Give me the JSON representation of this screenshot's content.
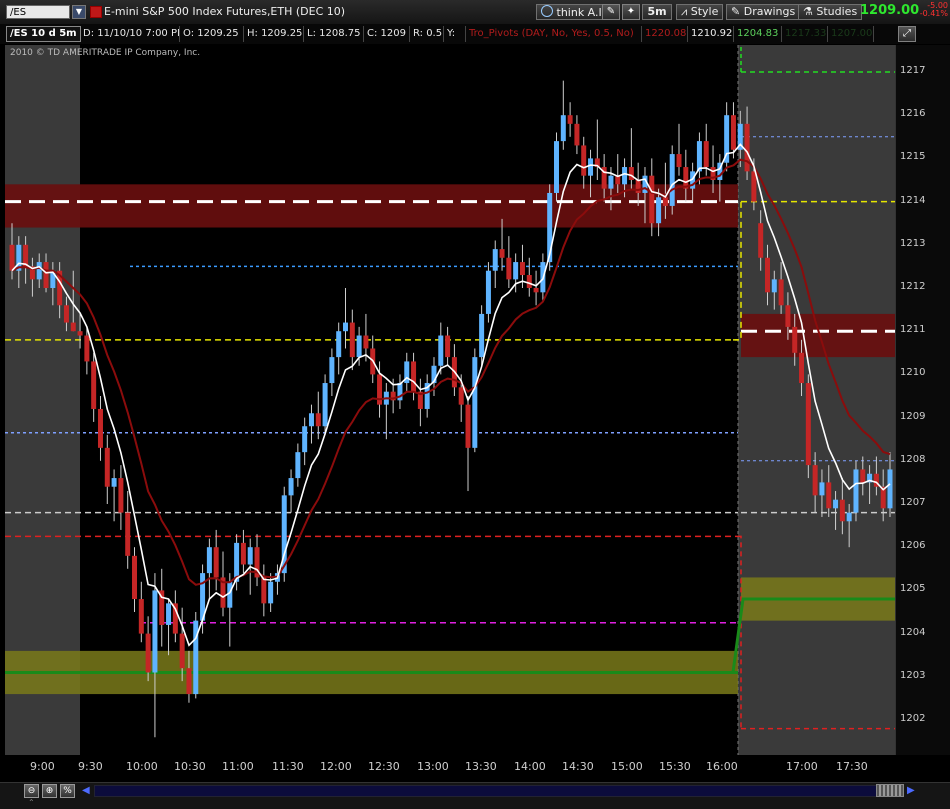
{
  "toolbar": {
    "symbol": "/ES",
    "title": "E-mini S&P 500 Index Futures,ETH (DEC 10)",
    "think_ai": "think A.I.",
    "timeframe": "5m",
    "style": "Style",
    "drawings": "Drawings",
    "studies": "Studies",
    "last_price": "1209.00",
    "net_change": "-5.00",
    "net_change_pct": "-0.41%"
  },
  "infobar": {
    "period": "/ES 10 d 5m",
    "date": "D: 11/10/10 7:00 PM",
    "open": "O: 1209.25",
    "high": "H: 1209.25",
    "low": "L: 1208.75",
    "close": "C: 1209",
    "range": "R: 0.5",
    "y": "Y:",
    "study": "Tro_Pivots (DAY, No, Yes, 0.5, No)",
    "v1": "1220.08",
    "v2": "1210.92",
    "v3": "1204.83",
    "v4": "1217.33",
    "v5": "1207.00"
  },
  "copyright": "2010 © TD AMERITRADE IP Company, Inc.",
  "colors": {
    "bull": "#5fb4ff",
    "bear": "#c52626",
    "ema_fast": "#ffffff",
    "ema_slow": "#8b0c0c",
    "resistance_zone": "#6a0e0e",
    "support_zone": "#7a7a1a"
  },
  "chart_data": {
    "type": "candlestick",
    "title": "E-mini S&P 500 Index Futures,ETH (DEC 10)",
    "ylim": [
      1201.5,
      1217.5
    ],
    "y_ticks": [
      "1217",
      "1216",
      "1215",
      "1214",
      "1213",
      "1212",
      "1211",
      "1210",
      "1209",
      "1208",
      "1207",
      "1206",
      "1205",
      "1204",
      "1203",
      "1202"
    ],
    "x_ticks": [
      "9:00",
      "9:30",
      "10:00",
      "10:30",
      "11:00",
      "11:30",
      "12:00",
      "12:30",
      "13:00",
      "13:30",
      "14:00",
      "14:30",
      "15:00",
      "15:30",
      "16:00",
      "17:00",
      "17:30"
    ],
    "regular_session": [
      "9:30",
      "16:15"
    ],
    "levels": [
      {
        "name": "day-high-pivot",
        "value": 1214.0,
        "color": "#ffffff",
        "style": "dash-thick"
      },
      {
        "name": "blue-dotted",
        "value": 1212.5,
        "color": "#3a9bff",
        "style": "dot"
      },
      {
        "name": "yellow-dash",
        "value": 1210.8,
        "color": "#e6e600",
        "style": "dash"
      },
      {
        "name": "light-blue",
        "value": 1208.65,
        "color": "#7fa0ff",
        "style": "dot"
      },
      {
        "name": "gray-dash",
        "value": 1206.8,
        "color": "#cccccc",
        "style": "dash"
      },
      {
        "name": "red-dash",
        "value": 1206.25,
        "color": "#e02020",
        "style": "dash"
      },
      {
        "name": "magenta-dash",
        "value": 1204.25,
        "color": "#e020e0",
        "style": "dash"
      },
      {
        "name": "green-line",
        "value": 1203.1,
        "color": "#1a8a1a",
        "style": "solid"
      }
    ],
    "candles": [
      [
        1213.0,
        1213.5,
        1212.2,
        1212.4
      ],
      [
        1212.4,
        1213.2,
        1212.0,
        1213.0
      ],
      [
        1213.0,
        1213.2,
        1212.1,
        1212.5
      ],
      [
        1212.5,
        1212.7,
        1211.8,
        1212.2
      ],
      [
        1212.2,
        1212.8,
        1212.0,
        1212.6
      ],
      [
        1212.6,
        1212.8,
        1211.9,
        1212.0
      ],
      [
        1212.0,
        1212.6,
        1211.6,
        1212.4
      ],
      [
        1212.4,
        1212.6,
        1211.3,
        1211.6
      ],
      [
        1211.6,
        1211.8,
        1211.0,
        1211.2
      ],
      [
        1211.2,
        1212.4,
        1211.0,
        1211.0
      ],
      [
        1211.0,
        1211.4,
        1210.6,
        1210.9
      ],
      [
        1210.9,
        1211.1,
        1210.0,
        1210.3
      ],
      [
        1210.3,
        1210.5,
        1208.9,
        1209.2
      ],
      [
        1209.2,
        1209.5,
        1208.0,
        1208.3
      ],
      [
        1208.3,
        1208.6,
        1207.0,
        1207.4
      ],
      [
        1207.4,
        1207.8,
        1206.6,
        1207.6
      ],
      [
        1207.6,
        1207.9,
        1206.4,
        1206.8
      ],
      [
        1206.8,
        1207.3,
        1205.5,
        1205.8
      ],
      [
        1205.8,
        1206.0,
        1204.5,
        1204.8
      ],
      [
        1204.8,
        1205.2,
        1203.8,
        1204.0
      ],
      [
        1204.0,
        1204.4,
        1202.9,
        1203.1
      ],
      [
        1203.1,
        1205.4,
        1201.6,
        1205.0
      ],
      [
        1205.0,
        1205.5,
        1203.7,
        1204.2
      ],
      [
        1204.2,
        1204.8,
        1203.5,
        1204.7
      ],
      [
        1204.7,
        1205.0,
        1203.8,
        1204.0
      ],
      [
        1204.0,
        1204.6,
        1202.9,
        1203.2
      ],
      [
        1203.2,
        1203.6,
        1202.4,
        1202.6
      ],
      [
        1202.6,
        1204.5,
        1202.5,
        1204.3
      ],
      [
        1204.3,
        1205.6,
        1204.0,
        1205.4
      ],
      [
        1205.4,
        1206.2,
        1204.8,
        1206.0
      ],
      [
        1206.0,
        1206.4,
        1205.0,
        1205.3
      ],
      [
        1205.3,
        1205.9,
        1204.4,
        1204.6
      ],
      [
        1204.6,
        1205.4,
        1203.7,
        1205.2
      ],
      [
        1205.2,
        1206.3,
        1205.0,
        1206.1
      ],
      [
        1206.1,
        1206.4,
        1205.4,
        1205.6
      ],
      [
        1205.6,
        1206.2,
        1204.9,
        1206.0
      ],
      [
        1206.0,
        1206.3,
        1205.1,
        1205.3
      ],
      [
        1205.3,
        1205.6,
        1204.4,
        1204.7
      ],
      [
        1204.7,
        1205.4,
        1204.5,
        1205.2
      ],
      [
        1205.2,
        1205.6,
        1204.9,
        1205.4
      ],
      [
        1205.4,
        1207.4,
        1205.2,
        1207.2
      ],
      [
        1207.2,
        1207.8,
        1206.8,
        1207.6
      ],
      [
        1207.6,
        1208.4,
        1207.4,
        1208.2
      ],
      [
        1208.2,
        1209.0,
        1207.9,
        1208.8
      ],
      [
        1208.8,
        1209.3,
        1208.4,
        1209.1
      ],
      [
        1209.1,
        1209.6,
        1208.5,
        1208.8
      ],
      [
        1208.8,
        1210.0,
        1208.6,
        1209.8
      ],
      [
        1209.8,
        1210.6,
        1209.5,
        1210.4
      ],
      [
        1210.4,
        1211.2,
        1210.0,
        1211.0
      ],
      [
        1211.0,
        1212.0,
        1210.6,
        1211.2
      ],
      [
        1211.2,
        1211.5,
        1210.1,
        1210.4
      ],
      [
        1210.4,
        1211.1,
        1210.2,
        1210.9
      ],
      [
        1210.9,
        1211.4,
        1210.3,
        1210.6
      ],
      [
        1210.6,
        1210.9,
        1209.8,
        1210.0
      ],
      [
        1210.0,
        1210.3,
        1209.0,
        1209.3
      ],
      [
        1209.3,
        1209.8,
        1208.5,
        1209.6
      ],
      [
        1209.6,
        1209.9,
        1209.1,
        1209.4
      ],
      [
        1209.4,
        1210.0,
        1209.2,
        1209.8
      ],
      [
        1209.8,
        1210.5,
        1209.6,
        1210.3
      ],
      [
        1210.3,
        1210.5,
        1209.4,
        1209.6
      ],
      [
        1209.6,
        1209.9,
        1208.8,
        1209.2
      ],
      [
        1209.2,
        1210.0,
        1209.0,
        1209.8
      ],
      [
        1209.8,
        1210.4,
        1209.5,
        1210.2
      ],
      [
        1210.2,
        1211.2,
        1210.0,
        1210.9
      ],
      [
        1210.9,
        1211.1,
        1210.2,
        1210.4
      ],
      [
        1210.4,
        1210.7,
        1209.5,
        1209.7
      ],
      [
        1209.7,
        1210.0,
        1208.9,
        1209.3
      ],
      [
        1209.3,
        1209.5,
        1207.3,
        1208.3
      ],
      [
        1208.3,
        1210.6,
        1208.2,
        1210.4
      ],
      [
        1210.4,
        1211.6,
        1210.2,
        1211.4
      ],
      [
        1211.4,
        1212.6,
        1211.2,
        1212.4
      ],
      [
        1212.4,
        1213.1,
        1212.0,
        1212.9
      ],
      [
        1212.9,
        1213.6,
        1212.4,
        1212.7
      ],
      [
        1212.7,
        1213.2,
        1212.0,
        1212.2
      ],
      [
        1212.2,
        1212.8,
        1211.9,
        1212.6
      ],
      [
        1212.6,
        1213.0,
        1212.0,
        1212.3
      ],
      [
        1212.3,
        1212.7,
        1211.8,
        1212.0
      ],
      [
        1212.0,
        1212.4,
        1211.6,
        1211.9
      ],
      [
        1211.9,
        1212.8,
        1211.7,
        1212.6
      ],
      [
        1212.6,
        1214.4,
        1212.4,
        1214.2
      ],
      [
        1214.2,
        1215.6,
        1214.0,
        1215.4
      ],
      [
        1215.4,
        1216.8,
        1215.2,
        1216.0
      ],
      [
        1216.0,
        1216.3,
        1215.5,
        1215.8
      ],
      [
        1215.8,
        1216.0,
        1215.1,
        1215.3
      ],
      [
        1215.3,
        1215.5,
        1214.3,
        1214.6
      ],
      [
        1214.6,
        1215.2,
        1214.1,
        1215.0
      ],
      [
        1215.0,
        1215.9,
        1214.5,
        1214.8
      ],
      [
        1214.8,
        1215.1,
        1214.0,
        1214.3
      ],
      [
        1214.3,
        1214.8,
        1213.8,
        1214.6
      ],
      [
        1214.6,
        1215.1,
        1214.2,
        1214.4
      ],
      [
        1214.4,
        1215.0,
        1214.1,
        1214.8
      ],
      [
        1214.8,
        1215.7,
        1214.3,
        1214.5
      ],
      [
        1214.5,
        1214.9,
        1213.9,
        1214.2
      ],
      [
        1214.2,
        1214.8,
        1213.5,
        1214.6
      ],
      [
        1214.6,
        1215.0,
        1213.2,
        1213.5
      ],
      [
        1213.5,
        1214.3,
        1213.2,
        1214.1
      ],
      [
        1214.1,
        1214.9,
        1213.6,
        1213.9
      ],
      [
        1213.9,
        1215.3,
        1213.7,
        1215.1
      ],
      [
        1215.1,
        1215.8,
        1214.6,
        1214.8
      ],
      [
        1214.8,
        1215.2,
        1214.0,
        1214.3
      ],
      [
        1214.3,
        1214.9,
        1214.0,
        1214.7
      ],
      [
        1214.7,
        1215.6,
        1214.4,
        1215.4
      ],
      [
        1215.4,
        1215.8,
        1214.6,
        1214.8
      ],
      [
        1214.8,
        1215.3,
        1214.2,
        1214.5
      ],
      [
        1214.5,
        1215.1,
        1214.0,
        1214.9
      ],
      [
        1214.9,
        1216.3,
        1214.7,
        1216.0
      ],
      [
        1216.0,
        1216.3,
        1215.0,
        1215.2
      ],
      [
        1215.2,
        1216.1,
        1214.8,
        1215.8
      ],
      [
        1215.8,
        1216.2,
        1214.5,
        1214.7
      ],
      [
        1214.7,
        1215.0,
        1213.8,
        1214.0
      ],
      [
        1213.5,
        1213.8,
        1212.4,
        1212.7
      ],
      [
        1212.7,
        1213.0,
        1211.6,
        1211.9
      ],
      [
        1211.9,
        1212.4,
        1211.5,
        1212.2
      ],
      [
        1212.2,
        1212.6,
        1211.4,
        1211.6
      ],
      [
        1211.6,
        1211.9,
        1210.8,
        1211.1
      ],
      [
        1211.1,
        1211.4,
        1210.2,
        1210.5
      ],
      [
        1210.5,
        1210.8,
        1209.5,
        1209.8
      ],
      [
        1209.8,
        1210.0,
        1207.6,
        1207.9
      ],
      [
        1207.9,
        1208.2,
        1206.8,
        1207.2
      ],
      [
        1207.2,
        1207.8,
        1206.7,
        1207.5
      ],
      [
        1207.5,
        1207.9,
        1206.7,
        1206.9
      ],
      [
        1206.9,
        1207.3,
        1206.4,
        1207.1
      ],
      [
        1207.1,
        1207.6,
        1206.3,
        1206.6
      ],
      [
        1206.6,
        1207.0,
        1206.0,
        1206.8
      ],
      [
        1206.8,
        1208.0,
        1206.6,
        1207.8
      ],
      [
        1207.8,
        1208.1,
        1207.2,
        1207.5
      ],
      [
        1207.5,
        1207.9,
        1207.0,
        1207.7
      ],
      [
        1207.7,
        1208.1,
        1207.2,
        1207.4
      ],
      [
        1207.4,
        1207.8,
        1206.6,
        1206.9
      ],
      [
        1206.9,
        1208.2,
        1206.7,
        1207.8
      ]
    ]
  }
}
